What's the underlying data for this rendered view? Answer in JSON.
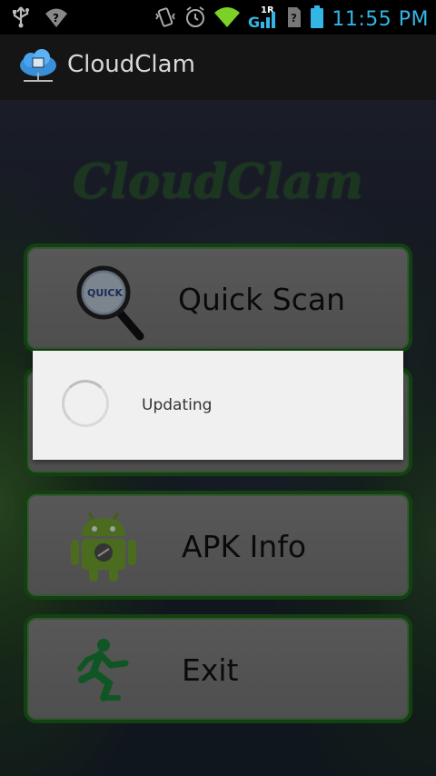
{
  "status_bar": {
    "time": "11:55 PM",
    "network_type": "G",
    "roaming_badge": "1R",
    "icons": [
      "usb-icon",
      "wifi-question-icon",
      "vibrate-icon",
      "alarm-icon",
      "wifi-icon",
      "signal-icon",
      "sim-unknown-icon",
      "battery-icon"
    ],
    "time_color": "#33b5e5"
  },
  "action_bar": {
    "title": "CloudClam",
    "icon": "cloud-computer-icon"
  },
  "main": {
    "logo_text": "CloudClam",
    "buttons": [
      {
        "label": "Quick Scan",
        "icon": "magnifier-quick-icon",
        "icon_text": "QUICK"
      },
      {
        "label": "",
        "icon": ""
      },
      {
        "label": "APK Info",
        "icon": "android-icon"
      },
      {
        "label": "Exit",
        "icon": "running-man-exit-icon"
      }
    ],
    "accent_border": "#1e6b1c"
  },
  "dialog": {
    "message": "Updating",
    "icon": "progress-spinner-icon"
  }
}
